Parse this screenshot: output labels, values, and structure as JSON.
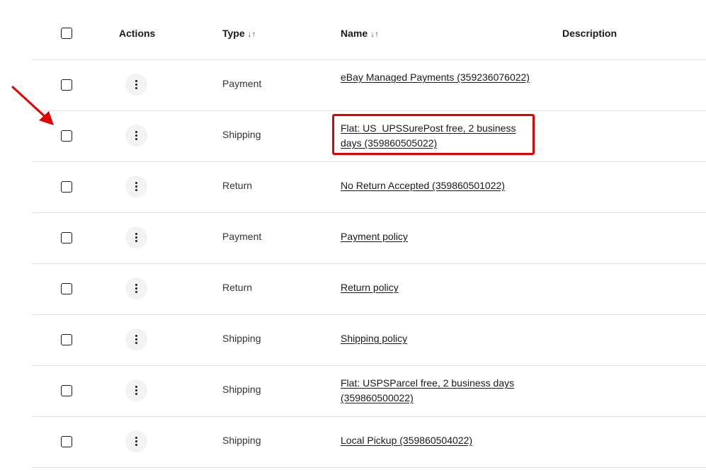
{
  "headers": {
    "actions": "Actions",
    "type": "Type",
    "name": "Name",
    "description": "Description",
    "sort_icon": "sort-arrows-icon",
    "sort_glyph": "↓↑"
  },
  "rows": [
    {
      "type": "Payment",
      "name": "eBay Managed Payments (359236076022)"
    },
    {
      "type": "Shipping",
      "name": "Flat: US_UPSSurePost free, 2 business days (359860505022)"
    },
    {
      "type": "Return",
      "name": "No Return Accepted (359860501022)"
    },
    {
      "type": "Payment",
      "name": "Payment policy"
    },
    {
      "type": "Return",
      "name": "Return policy"
    },
    {
      "type": "Shipping",
      "name": "Shipping policy"
    },
    {
      "type": "Shipping",
      "name": "Flat: USPSParcel free, 2 business days (359860500022)"
    },
    {
      "type": "Shipping",
      "name": "Local Pickup (359860504022)"
    }
  ],
  "annotation": {
    "highlight_color": "#e50000",
    "arrow_color": "#e50000",
    "highlighted_row_index": 1
  }
}
